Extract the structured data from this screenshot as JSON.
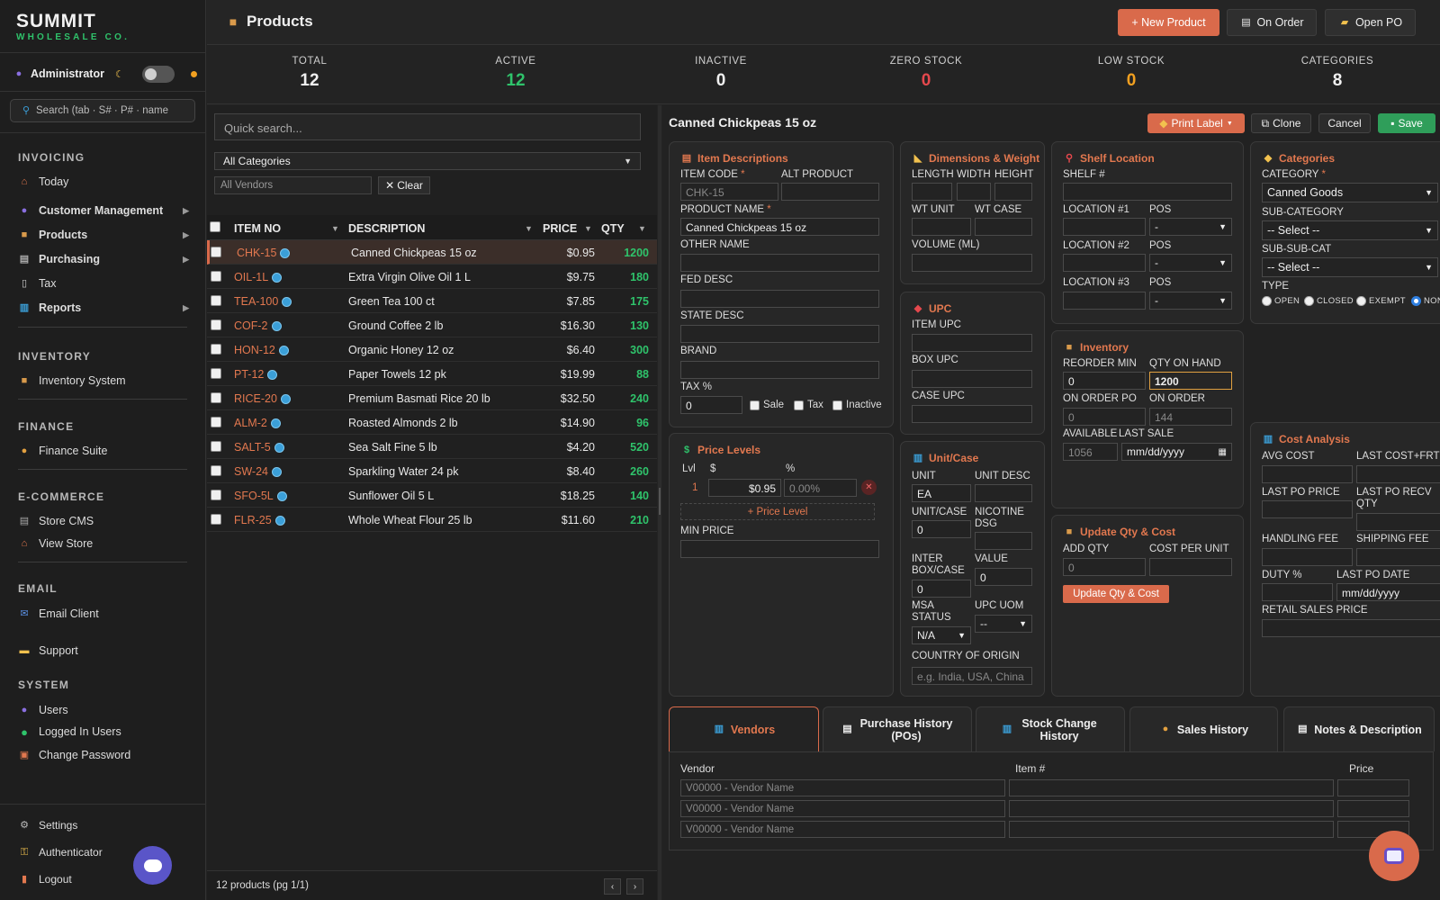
{
  "brand": {
    "name": "SUMMIT",
    "sub": "WHOLESALE CO."
  },
  "user": {
    "name": "Administrator",
    "moon": "☾"
  },
  "sidebar_search": {
    "placeholder": "Search  (tab · S# · P# · name"
  },
  "sections": {
    "invoicing": "INVOICING",
    "inventory": "INVENTORY",
    "finance": "FINANCE",
    "ecommerce": "E-COMMERCE",
    "email": "EMAIL",
    "system": "SYSTEM"
  },
  "nav": {
    "today": "Today",
    "customer_management": "Customer Management",
    "products": "Products",
    "purchasing": "Purchasing",
    "tax": "Tax",
    "reports": "Reports",
    "inventory_system": "Inventory System",
    "finance_suite": "Finance Suite",
    "store_cms": "Store CMS",
    "view_store": "View Store",
    "email_client": "Email Client",
    "support": "Support",
    "users": "Users",
    "logged_in_users": "Logged In Users",
    "change_password": "Change Password",
    "settings": "Settings",
    "authenticator": "Authenticator",
    "logout": "Logout"
  },
  "header": {
    "title": "Products",
    "new_product": "+ New Product",
    "on_order": "On Order",
    "open_po": "Open PO"
  },
  "stats": [
    {
      "label": "TOTAL",
      "value": "12",
      "color": "#f0f0f0"
    },
    {
      "label": "ACTIVE",
      "value": "12",
      "color": "#2fc36b"
    },
    {
      "label": "INACTIVE",
      "value": "0",
      "color": "#f0f0f0"
    },
    {
      "label": "ZERO STOCK",
      "value": "0",
      "color": "#e5484d"
    },
    {
      "label": "LOW STOCK",
      "value": "0",
      "color": "#f2a020"
    },
    {
      "label": "CATEGORIES",
      "value": "8",
      "color": "#f0f0f0"
    }
  ],
  "list": {
    "quick_search": "Quick search...",
    "category_filter": "All Categories",
    "vendor_filter": "All Vendors",
    "clear": "Clear",
    "columns": {
      "item_no": "ITEM NO",
      "description": "DESCRIPTION",
      "price": "PRICE",
      "qty": "QTY"
    },
    "rows": [
      {
        "item": "CHK-15",
        "desc": "Canned Chickpeas 15 oz",
        "price": "$0.95",
        "qty": "1200"
      },
      {
        "item": "OIL-1L",
        "desc": "Extra Virgin Olive Oil 1 L",
        "price": "$9.75",
        "qty": "180"
      },
      {
        "item": "TEA-100",
        "desc": "Green Tea 100 ct",
        "price": "$7.85",
        "qty": "175"
      },
      {
        "item": "COF-2",
        "desc": "Ground Coffee 2 lb",
        "price": "$16.30",
        "qty": "130"
      },
      {
        "item": "HON-12",
        "desc": "Organic Honey 12 oz",
        "price": "$6.40",
        "qty": "300"
      },
      {
        "item": "PT-12",
        "desc": "Paper Towels 12 pk",
        "price": "$19.99",
        "qty": "88"
      },
      {
        "item": "RICE-20",
        "desc": "Premium Basmati Rice 20 lb",
        "price": "$32.50",
        "qty": "240"
      },
      {
        "item": "ALM-2",
        "desc": "Roasted Almonds 2 lb",
        "price": "$14.90",
        "qty": "96"
      },
      {
        "item": "SALT-5",
        "desc": "Sea Salt Fine 5 lb",
        "price": "$4.20",
        "qty": "520"
      },
      {
        "item": "SW-24",
        "desc": "Sparkling Water 24 pk",
        "price": "$8.40",
        "qty": "260"
      },
      {
        "item": "SFO-5L",
        "desc": "Sunflower Oil 5 L",
        "price": "$18.25",
        "qty": "140"
      },
      {
        "item": "FLR-25",
        "desc": "Whole Wheat Flour 25 lb",
        "price": "$11.60",
        "qty": "210"
      }
    ],
    "footer_count": "12 products (pg 1/1)"
  },
  "detail": {
    "title": "Canned Chickpeas 15 oz",
    "print_label": "Print Label",
    "clone": "Clone",
    "cancel": "Cancel",
    "save": "Save",
    "item_desc": {
      "title": "Item Descriptions",
      "item_code_label": "ITEM CODE",
      "item_code": "CHK-15",
      "alt_product_label": "ALT PRODUCT",
      "product_name_label": "PRODUCT NAME",
      "product_name": "Canned Chickpeas 15 oz",
      "other_name_label": "OTHER NAME",
      "fed_desc_label": "FED DESC",
      "state_desc_label": "STATE DESC",
      "brand_label": "BRAND",
      "tax_label": "TAX %",
      "tax": "0",
      "sale": "Sale",
      "tax_cb": "Tax",
      "inactive": "Inactive"
    },
    "price_levels": {
      "title": "Price Levels",
      "lvl": "Lvl",
      "dollar": "$",
      "pct": "%",
      "row_lvl": "1",
      "row_price": "$0.95",
      "row_pct": "0.00%",
      "add": "+ Price Level",
      "min_price_label": "MIN PRICE"
    },
    "dimensions": {
      "title": "Dimensions & Weight",
      "length": "LENGTH",
      "width": "WIDTH",
      "height": "HEIGHT",
      "wt_unit": "WT UNIT",
      "wt_case": "WT CASE",
      "volume": "VOLUME (ML)"
    },
    "upc": {
      "title": "UPC",
      "item_upc": "ITEM UPC",
      "box_upc": "BOX UPC",
      "case_upc": "CASE UPC"
    },
    "unit_case": {
      "title": "Unit/Case",
      "unit_label": "UNIT",
      "unit": "EA",
      "unit_desc_label": "UNIT DESC",
      "unit_case_label": "UNIT/CASE",
      "unit_case": "0",
      "nicotine_label": "NICOTINE DSG",
      "inter_box_label": "INTER BOX/CASE",
      "inter_box": "0",
      "value_label": "VALUE",
      "value": "0",
      "msa_label": "MSA STATUS",
      "msa": "N/A",
      "upc_uom_label": "UPC UOM",
      "upc_uom": "--",
      "country_label": "COUNTRY OF ORIGIN",
      "country_placeholder": "e.g. India, USA, China"
    },
    "shelf": {
      "title": "Shelf Location",
      "shelf_label": "SHELF #",
      "loc1": "LOCATION #1",
      "loc2": "LOCATION #2",
      "loc3": "LOCATION #3",
      "pos": "POS",
      "pos_value": "-"
    },
    "inventory": {
      "title": "Inventory",
      "reorder_label": "REORDER MIN",
      "reorder": "0",
      "qoh_label": "QTY ON HAND",
      "qoh": "1200",
      "on_order_po_label": "ON ORDER PO",
      "on_order_po": "0",
      "on_order_label": "ON ORDER",
      "on_order": "144",
      "available_label": "AVAILABLE",
      "available": "1056",
      "last_sale_label": "LAST SALE",
      "date_placeholder": "mm/dd/yyyy"
    },
    "update": {
      "title": "Update Qty & Cost",
      "add_qty_label": "ADD QTY",
      "add_qty": "0",
      "cost_label": "COST PER UNIT",
      "button": "Update Qty & Cost"
    },
    "categories": {
      "title": "Categories",
      "category_label": "CATEGORY",
      "category": "Canned Goods",
      "sub_label": "SUB-CATEGORY",
      "sub": "-- Select --",
      "subsub_label": "SUB-SUB-CAT",
      "subsub": "-- Select --",
      "type_label": "TYPE",
      "types": [
        "OPEN",
        "CLOSED",
        "EXEMPT",
        "NON"
      ]
    },
    "cost": {
      "title": "Cost Analysis",
      "avg_cost": "AVG COST",
      "last_cost": "LAST COST+FRT",
      "last_po_price": "LAST PO PRICE",
      "last_po_recv": "LAST PO RECV QTY",
      "handling": "HANDLING FEE",
      "shipping": "SHIPPING FEE",
      "duty": "DUTY %",
      "last_po_date": "LAST PO DATE",
      "date_placeholder": "mm/dd/yyyy",
      "retail": "RETAIL SALES PRICE"
    }
  },
  "tabs": [
    {
      "label": "Vendors"
    },
    {
      "label": "Purchase History (POs)"
    },
    {
      "label": "Stock Change History"
    },
    {
      "label": "Sales History"
    },
    {
      "label": "Notes & Description"
    }
  ],
  "vendors": {
    "col_vendor": "Vendor",
    "col_item": "Item #",
    "col_price": "Price",
    "placeholder": "V00000 - Vendor Name"
  }
}
